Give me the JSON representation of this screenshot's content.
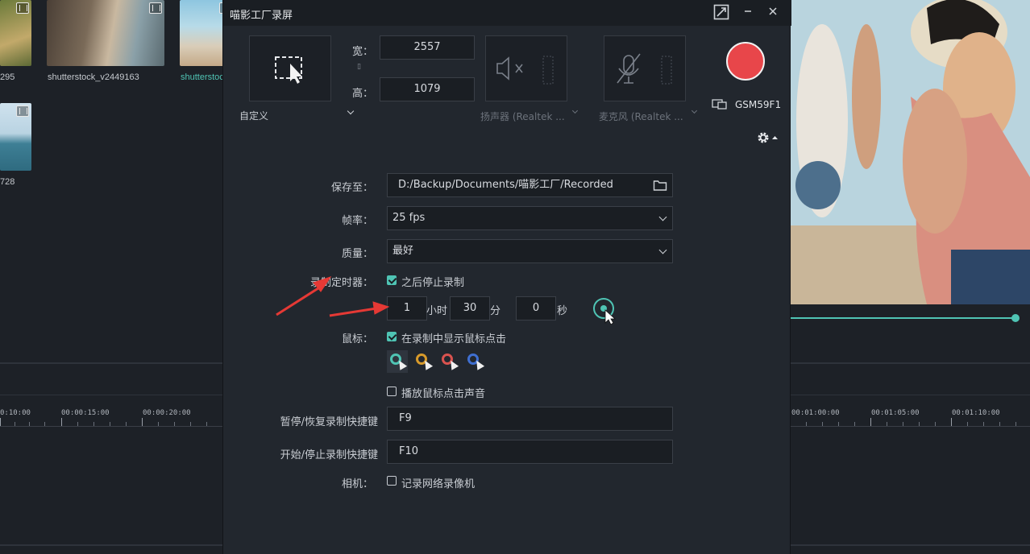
{
  "background_editor": {
    "thumbnails": [
      {
        "caption": "295"
      },
      {
        "caption": "shutterstock_v2449163"
      },
      {
        "caption": "shutterstoc"
      },
      {
        "caption": "728"
      }
    ],
    "timeline_left_labels": [
      "0:10:00",
      "00:00:15:00",
      "00:00:20:00"
    ],
    "timeline_right_labels": [
      "00:01:00:00",
      "00:01:05:00",
      "00:01:10:00"
    ]
  },
  "dialog": {
    "title": "喵影工厂录屏",
    "area": {
      "preset": "自定义",
      "width_label": "宽：",
      "height_label": "高：",
      "width": "2557",
      "height": "1079"
    },
    "speaker": {
      "label": "扬声器 (Realtek ..."
    },
    "mic": {
      "label": "麦克风 (Realtek ..."
    },
    "monitor": {
      "label": "GSM59F1"
    },
    "save_to": {
      "label": "保存至：",
      "value": "D:/Backup/Documents/喵影工厂/Recorded"
    },
    "frame_rate": {
      "label": "帧率：",
      "value": "25 fps"
    },
    "quality": {
      "label": "质量：",
      "value": "最好"
    },
    "timer": {
      "label": "录制定时器：",
      "checkbox_label": "之后停止录制",
      "hours": "1",
      "hours_unit": "小时",
      "minutes": "30",
      "minutes_unit": "分",
      "seconds": "0",
      "seconds_unit": "秒"
    },
    "mouse": {
      "label": "鼠标：",
      "checkbox_label": "在录制中显示鼠标点击",
      "sound_label": "播放鼠标点击声音"
    },
    "pause_hotkey": {
      "label": "暂停/恢复录制快捷键",
      "value": "F9"
    },
    "start_hotkey": {
      "label": "开始/停止录制快捷键",
      "value": "F10"
    },
    "camera": {
      "label": "相机：",
      "checkbox_label": "记录网络录像机"
    }
  },
  "colors": {
    "accent": "#4fc4b4",
    "record": "#e8464a",
    "annotation": "#e53935"
  }
}
